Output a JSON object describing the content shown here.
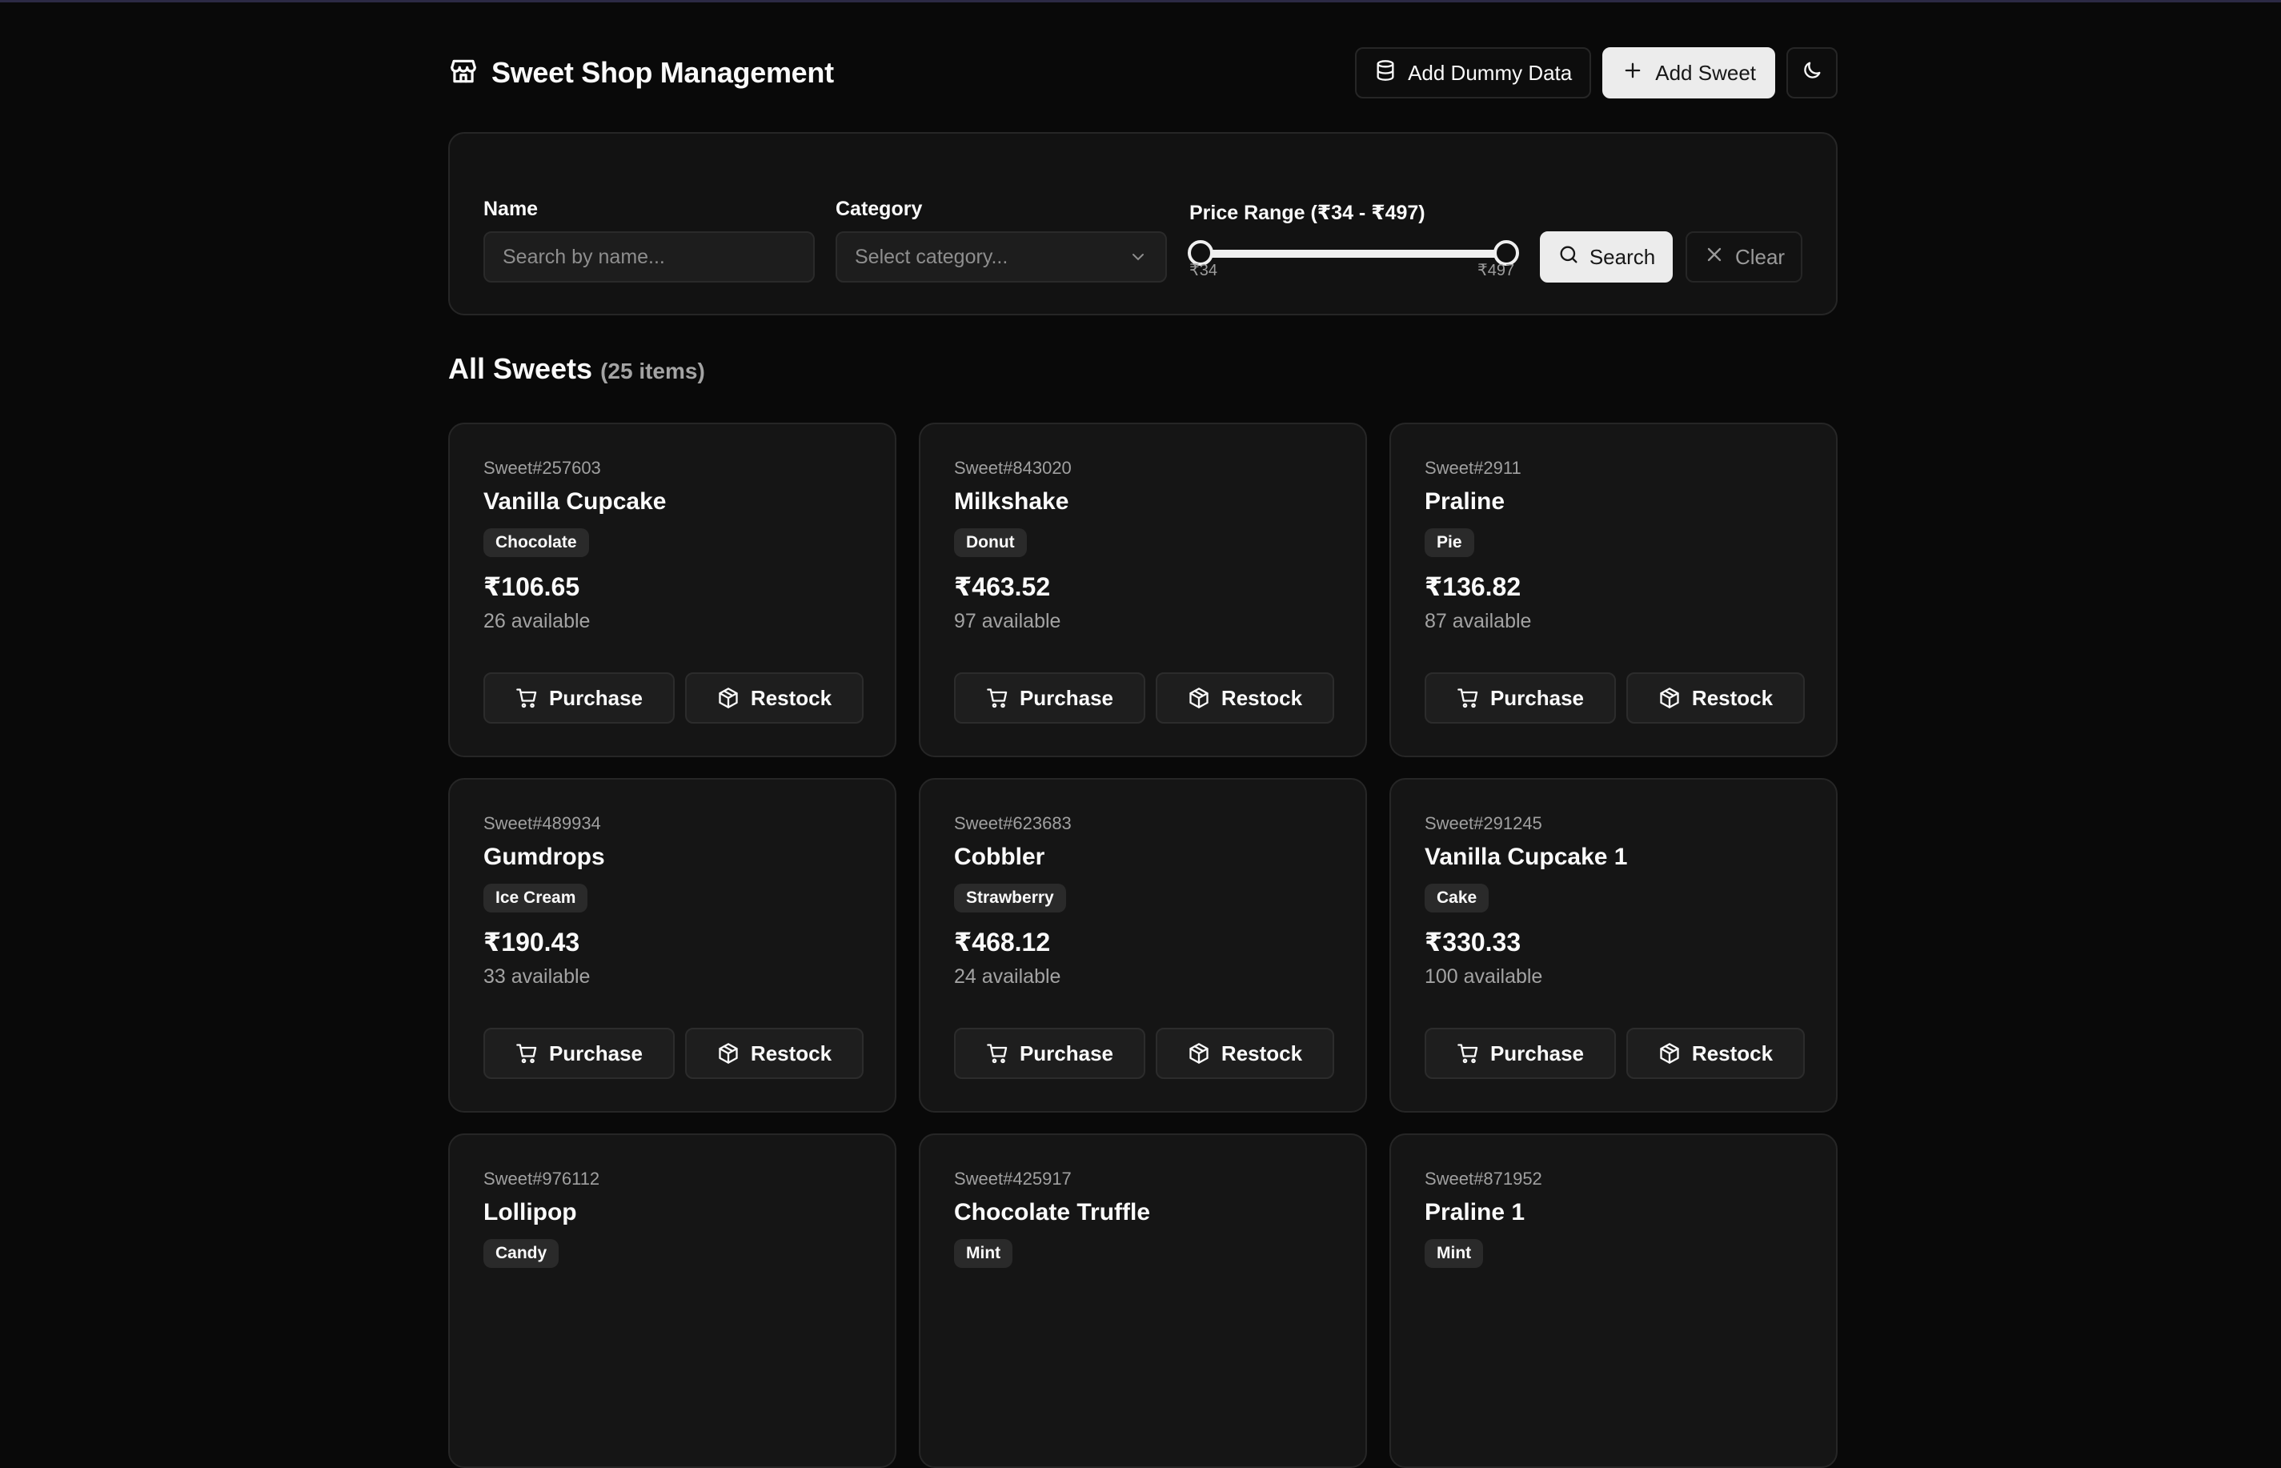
{
  "header": {
    "title": "Sweet Shop Management",
    "add_dummy_label": "Add Dummy Data",
    "add_sweet_label": "Add Sweet"
  },
  "filters": {
    "name_label": "Name",
    "name_placeholder": "Search by name...",
    "category_label": "Category",
    "category_placeholder": "Select category...",
    "price_label": "Price Range (₹34 - ₹497)",
    "price_min": "₹34",
    "price_max": "₹497",
    "search_label": "Search",
    "clear_label": "Clear"
  },
  "section": {
    "title": "All Sweets",
    "count": "(25 items)"
  },
  "card_buttons": {
    "purchase": "Purchase",
    "restock": "Restock"
  },
  "sweets": [
    {
      "id": "Sweet#257603",
      "name": "Vanilla Cupcake",
      "category": "Chocolate",
      "price": "₹106.65",
      "available": "26 available"
    },
    {
      "id": "Sweet#843020",
      "name": "Milkshake",
      "category": "Donut",
      "price": "₹463.52",
      "available": "97 available"
    },
    {
      "id": "Sweet#2911",
      "name": "Praline",
      "category": "Pie",
      "price": "₹136.82",
      "available": "87 available"
    },
    {
      "id": "Sweet#489934",
      "name": "Gumdrops",
      "category": "Ice Cream",
      "price": "₹190.43",
      "available": "33 available"
    },
    {
      "id": "Sweet#623683",
      "name": "Cobbler",
      "category": "Strawberry",
      "price": "₹468.12",
      "available": "24 available"
    },
    {
      "id": "Sweet#291245",
      "name": "Vanilla Cupcake 1",
      "category": "Cake",
      "price": "₹330.33",
      "available": "100 available"
    },
    {
      "id": "Sweet#976112",
      "name": "Lollipop",
      "category": "Candy",
      "price": "",
      "available": ""
    },
    {
      "id": "Sweet#425917",
      "name": "Chocolate Truffle",
      "category": "Mint",
      "price": "",
      "available": ""
    },
    {
      "id": "Sweet#871952",
      "name": "Praline 1",
      "category": "Mint",
      "price": "",
      "available": ""
    }
  ]
}
